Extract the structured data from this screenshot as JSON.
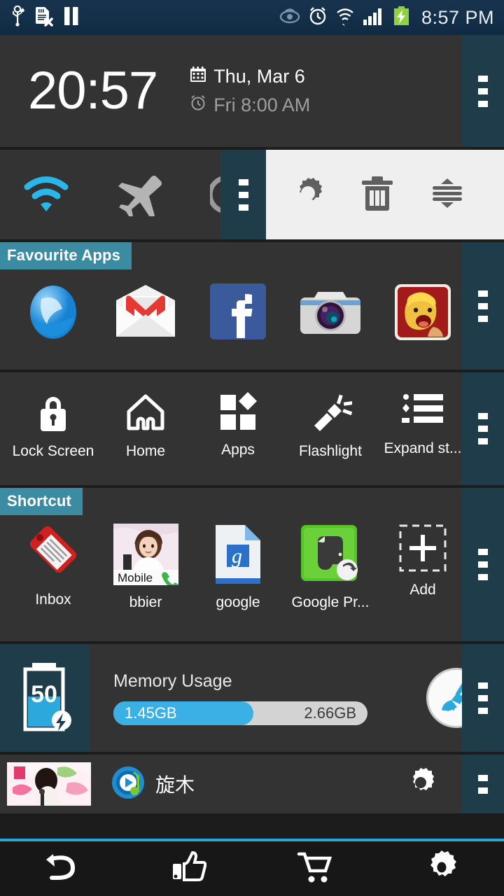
{
  "statusbar": {
    "time": "8:57 PM",
    "left_icons": [
      "usb-icon",
      "sd-card-error-icon",
      "pause-icon"
    ],
    "right_icons": [
      "eye-icon",
      "alarm-clock-icon",
      "wifi-transfer-icon",
      "signal-bars-icon",
      "battery-charging-icon"
    ]
  },
  "clock": {
    "time": "20:57",
    "date": "Thu, Mar 6",
    "alarm": "Fri 8:00 AM"
  },
  "toggles": {
    "items": [
      {
        "name": "wifi-toggle",
        "label": "Wi-Fi",
        "active": true,
        "color": "#29b6e8"
      },
      {
        "name": "airplane-toggle",
        "label": "Airplane mode",
        "active": false,
        "color": "#b4b4b4"
      },
      {
        "name": "bluetooth-toggle",
        "label": "Bluetooth",
        "active": false,
        "color": "#9a9a9a"
      }
    ]
  },
  "overlay_panel": {
    "items": [
      {
        "name": "settings-button",
        "label": "Settings"
      },
      {
        "name": "delete-button",
        "label": "Delete"
      },
      {
        "name": "reorder-button",
        "label": "Reorder"
      }
    ]
  },
  "favourite_apps": {
    "title": "Favourite Apps",
    "apps": [
      {
        "label": "Browser",
        "icon": "browser-icon"
      },
      {
        "label": "Gmail",
        "icon": "gmail-icon"
      },
      {
        "label": "Facebook",
        "icon": "facebook-icon"
      },
      {
        "label": "Camera",
        "icon": "camera-icon"
      },
      {
        "label": "Clash of Clans",
        "icon": "clash-of-clans-icon"
      }
    ]
  },
  "tools": {
    "items": [
      {
        "label": "Lock Screen",
        "icon": "lock-icon"
      },
      {
        "label": "Home",
        "icon": "home-icon"
      },
      {
        "label": "Apps",
        "icon": "apps-grid-icon"
      },
      {
        "label": "Flashlight",
        "icon": "flashlight-icon"
      },
      {
        "label": "Expand st...",
        "icon": "list-icon"
      }
    ]
  },
  "shortcut": {
    "title": "Shortcut",
    "items": [
      {
        "label": "Inbox",
        "icon": "tag-icon"
      },
      {
        "label": "bbier",
        "icon": "contact-photo-icon",
        "sub_label": "Mobile"
      },
      {
        "label": "google",
        "icon": "google-doc-icon"
      },
      {
        "label": "Google Pr...",
        "icon": "evernote-shortcut-icon"
      },
      {
        "label": "Add",
        "icon": "add-plus-icon"
      }
    ]
  },
  "memory": {
    "title": "Memory Usage",
    "used": "1.45GB",
    "total": "2.66GB",
    "percent": 55,
    "battery_level": "50",
    "clean_icon": "broom-icon",
    "bar_color": "#3ab0e5"
  },
  "music": {
    "title": "旋木",
    "player_icon": "music-player-icon",
    "settings_icon": "gear-icon",
    "album_art": "album-art-thumbnail"
  },
  "bottombar": {
    "items": [
      {
        "name": "back-button",
        "label": "Back",
        "icon": "back-arrow-icon"
      },
      {
        "name": "like-button",
        "label": "Like",
        "icon": "thumbs-up-icon"
      },
      {
        "name": "store-button",
        "label": "Store",
        "icon": "shopping-cart-icon"
      },
      {
        "name": "settings-button",
        "label": "Settings",
        "icon": "gear-icon"
      }
    ]
  }
}
